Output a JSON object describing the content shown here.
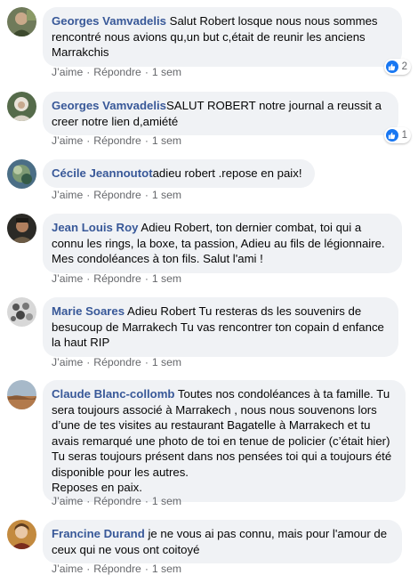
{
  "comments": [
    {
      "author": "Georges Vamvadelis",
      "text": " Salut Robert losque nous nous sommes rencontré nous avions qu,un but c,était de reunir les anciens Marrakchis",
      "actions": {
        "like": "J’aime",
        "reply": "Répondre",
        "time": "1 sem"
      },
      "reactions": "2"
    },
    {
      "author": "Georges Vamvadelis",
      "text": "SALUT ROBERT notre journal a reussit a creer notre lien d,amiété",
      "actions": {
        "like": "J’aime",
        "reply": "Répondre",
        "time": "1 sem"
      },
      "reactions": "1"
    },
    {
      "author": "Cécile Jeannoutot",
      "text": "adieu robert .repose en paix!",
      "actions": {
        "like": "J’aime",
        "reply": "Répondre",
        "time": "1 sem"
      }
    },
    {
      "author": "Jean Louis Roy",
      "text": " Adieu Robert, ton dernier combat, toi qui a connu les rings, la boxe, ta passion, Adieu au fils de légionnaire. Mes condoléances à ton fils. Salut l'ami !",
      "actions": {
        "like": "J’aime",
        "reply": "Répondre",
        "time": "1 sem"
      }
    },
    {
      "author": "Marie Soares",
      "text": " Adieu Robert Tu resteras ds les souvenirs de besucoup de Marrakech Tu vas rencontrer ton copain d enfance la haut RIP",
      "actions": {
        "like": "J’aime",
        "reply": "Répondre",
        "time": "1 sem"
      }
    },
    {
      "author": "Claude Blanc-collomb",
      "text": " Toutes nos condoléances à ta famille. Tu sera toujours associé à Marrakech , nous nous souvenons lors d’une de tes visites au restaurant Bagatelle à Marrakech et tu avais remarqué une photo de toi en tenue de policier (c’était hier) Tu seras toujours présent dans nos pensées toi qui a toujours été disponible pour les autres.",
      "text2": "Reposes en paix.",
      "actions": {
        "like": "J’aime",
        "reply": "Répondre",
        "time": "1 sem"
      }
    },
    {
      "author": "Francine Durand",
      "text": " je ne vous ai pas connu, mais pour l'amour de ceux qui ne vous ont coitoyé",
      "actions": {
        "like": "J’aime",
        "reply": "Répondre",
        "time": "1 sem"
      }
    }
  ],
  "colors": {
    "author": "#385898",
    "bubble": "#f0f2f5",
    "meta": "#65676b",
    "like": "#1877f2"
  }
}
